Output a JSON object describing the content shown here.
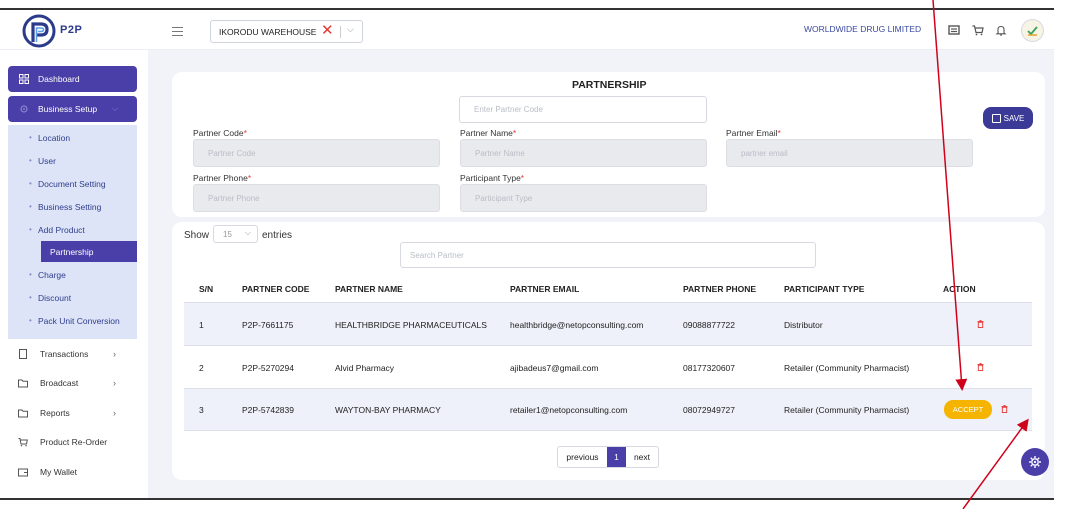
{
  "brand": {
    "logo_text": "P2P"
  },
  "header": {
    "warehouse_value": "IKORODU WAREHOUSE",
    "company_name": "WORLDWIDE DRUG LIMITED",
    "icons": [
      "menu-icon",
      "clear-icon",
      "chevron-down-icon",
      "list-icon",
      "cart-icon",
      "bell-icon",
      "avatar"
    ]
  },
  "sidebar": {
    "dashboard": "Dashboard",
    "business_setup": "Business Setup",
    "sub_items": [
      "Location",
      "User",
      "Document Setting",
      "Business Setting",
      "Add Product",
      "Partnership",
      "Charge",
      "Discount",
      "Pack Unit Conversion"
    ],
    "active_sub_item": "Partnership",
    "lower_items": [
      "Transactions",
      "Broadcast",
      "Reports",
      "Product Re-Order",
      "My Wallet"
    ]
  },
  "form": {
    "title": "PARTNERSHIP",
    "partner_code_lookup_placeholder": "Enter Partner Code",
    "save_label": "SAVE",
    "required_mark": "*",
    "fields": {
      "partner_code": {
        "label": "Partner Code",
        "placeholder": "Partner Code"
      },
      "partner_name": {
        "label": "Partner Name",
        "placeholder": "Partner Name"
      },
      "partner_email": {
        "label": "Partner Email",
        "placeholder": "partner email"
      },
      "partner_phone": {
        "label": "Partner Phone",
        "placeholder": "Partner Phone"
      },
      "participant_type": {
        "label": "Participant Type",
        "placeholder": "Participant Type"
      }
    }
  },
  "table": {
    "show_label": "Show",
    "entries_value": "15",
    "entries_label": "entries",
    "search_placeholder": "Search Partner",
    "headers": [
      "S/N",
      "PARTNER CODE",
      "PARTNER NAME",
      "PARTNER EMAIL",
      "PARTNER PHONE",
      "PARTICIPANT TYPE",
      "ACTION"
    ],
    "rows": [
      {
        "sn": "1",
        "code": "P2P-7661175",
        "name": "HEALTHBRIDGE PHARMACEUTICALS",
        "email": "healthbridge@netopconsulting.com",
        "phone": "09088877722",
        "type": "Distributor",
        "accept": false
      },
      {
        "sn": "2",
        "code": "P2P-5270294",
        "name": "Alvid Pharmacy",
        "email": "ajibadeus7@gmail.com",
        "phone": "08177320607",
        "type": "Retailer (Community Pharmacist)",
        "accept": false
      },
      {
        "sn": "3",
        "code": "P2P-5742839",
        "name": "WAYTON-BAY PHARMACY",
        "email": "retailer1@netopconsulting.com",
        "phone": "08072949727",
        "type": "Retailer (Community Pharmacist)",
        "accept": true
      }
    ],
    "accept_label": "ACCEPT"
  },
  "pagination": {
    "previous": "previous",
    "current": "1",
    "next": "next"
  },
  "colors": {
    "primary": "#4a3fa8",
    "accept": "#f5b400",
    "delete": "#e53935",
    "annotation_arrow": "#d0021b"
  }
}
